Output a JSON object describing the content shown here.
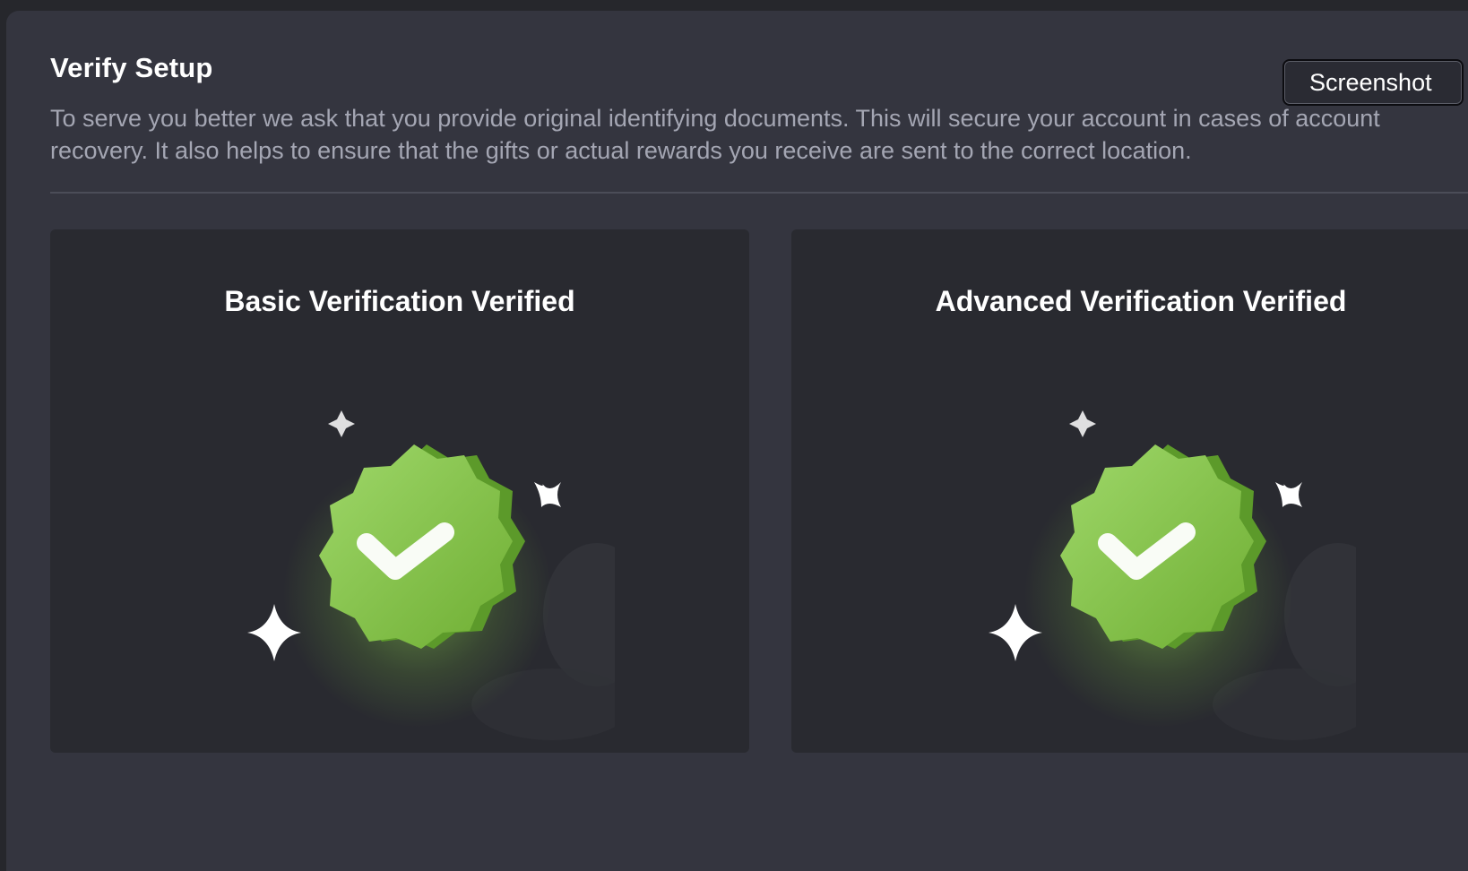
{
  "header": {
    "title": "Verify Setup",
    "description": "To serve you better we ask that you provide original identifying documents. This will secure your account in cases of account recovery. It also helps to ensure that the gifts or actual rewards you receive are sent to the correct location.",
    "screenshot_button": "Screenshot"
  },
  "cards": [
    {
      "title": "Basic Verification Verified",
      "icon": "verified-badge-icon"
    },
    {
      "title": "Advanced Verification Verified",
      "icon": "verified-badge-icon"
    }
  ],
  "colors": {
    "background": "#26272c",
    "panel": "#34353f",
    "card": "#292a30",
    "badge_green": "#8fd14f",
    "text_primary": "#ffffff",
    "text_secondary": "#a4a6b3"
  }
}
